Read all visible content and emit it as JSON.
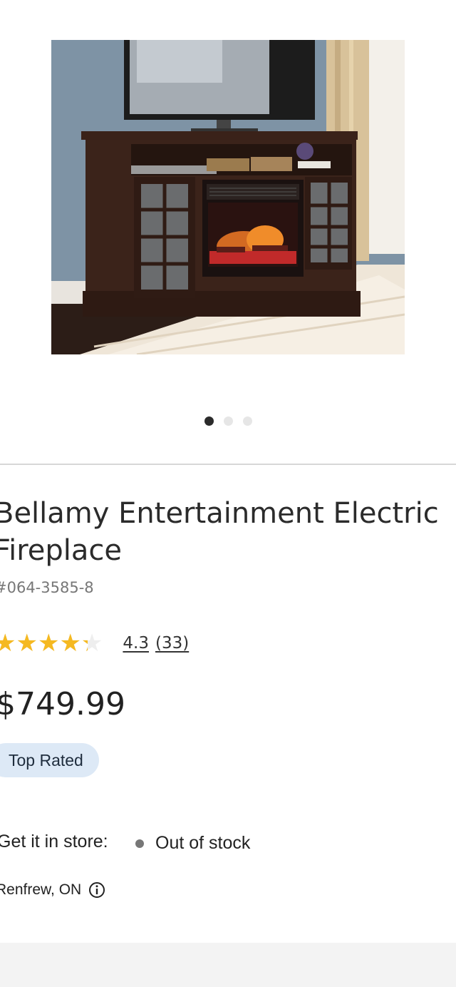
{
  "gallery": {
    "image_alt": "Bellamy Entertainment Electric Fireplace",
    "slide_count": 3,
    "active_slide": 1
  },
  "product": {
    "title": "Bellamy Entertainment Electric Fireplace",
    "sku": "#064-3585-8",
    "rating": {
      "stars_value": 4.3,
      "score": "4.3",
      "count": "(33)"
    },
    "price": "$749.99",
    "badge": "Top Rated"
  },
  "availability": {
    "store_label": "Get it in store:",
    "status": "Out of stock",
    "location": "Renfrew, ON"
  },
  "icons": {
    "info": "info-circle-icon",
    "star": "star-icon"
  },
  "colors": {
    "star_fill": "#f5b921",
    "badge_bg": "#dde9f6",
    "dot_active": "#2b2b2b",
    "dot_inactive": "#e6e6e6",
    "stock_dot": "#777777"
  }
}
